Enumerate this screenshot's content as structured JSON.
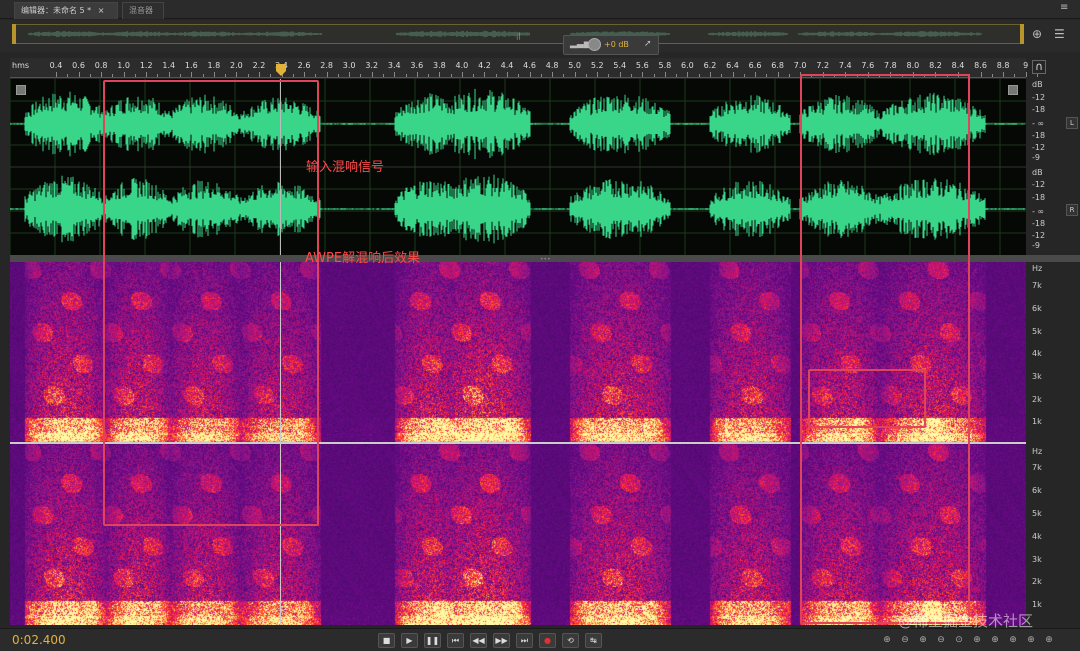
{
  "tabs": [
    {
      "label": "编辑器：未命名 5 *",
      "close": "×",
      "state": "active"
    },
    {
      "label": "混音器",
      "state": "inactive"
    }
  ],
  "panel_menu_icon": "panel-menu-icon",
  "level": {
    "value": "+0 dB"
  },
  "ruler": {
    "unit": "hms",
    "ticks": [
      "0.4",
      "0.6",
      "0.8",
      "1.0",
      "1.2",
      "1.4",
      "1.6",
      "1.8",
      "2.0",
      "2.2",
      "2.4",
      "2.6",
      "2.8",
      "3.0",
      "3.2",
      "3.4",
      "3.6",
      "3.8",
      "4.0",
      "4.2",
      "4.4",
      "4.6",
      "4.8",
      "5.0",
      "5.2",
      "5.4",
      "5.6",
      "5.8",
      "6.0",
      "6.2",
      "6.4",
      "6.6",
      "6.8",
      "7.0",
      "7.2",
      "7.4",
      "7.6",
      "7.8",
      "8.0",
      "8.2",
      "8.4",
      "8.6",
      "8.8",
      "9"
    ]
  },
  "db_scale": {
    "left": [
      "dB",
      "-12",
      "-18",
      "- ∞",
      "-18",
      "-12",
      "-9"
    ],
    "right": [
      "dB",
      "-12",
      "-18",
      "- ∞",
      "-18",
      "-12",
      "-9"
    ],
    "left_channel": "L",
    "right_channel": "R"
  },
  "hz_scale": {
    "top": [
      "Hz",
      "7k",
      "6k",
      "5k",
      "4k",
      "3k",
      "2k",
      "1k"
    ],
    "bottom": [
      "Hz",
      "7k",
      "6k",
      "5k",
      "4k",
      "3k",
      "2k",
      "1k"
    ]
  },
  "annotations": {
    "input_label": "输入混响信号",
    "output_label": "AWPE解混响后效果"
  },
  "timecode": "0:02.400",
  "transport": [
    "stop",
    "play",
    "pause",
    "go-to-start",
    "rewind",
    "fast-forward",
    "go-to-end",
    "record",
    "loop",
    "skip-selection"
  ],
  "watermark": "@稀土掘金技术社区",
  "colors": {
    "waveform": "#39d68a",
    "annotation": "#e0445a",
    "timecode": "#e2b23a"
  }
}
